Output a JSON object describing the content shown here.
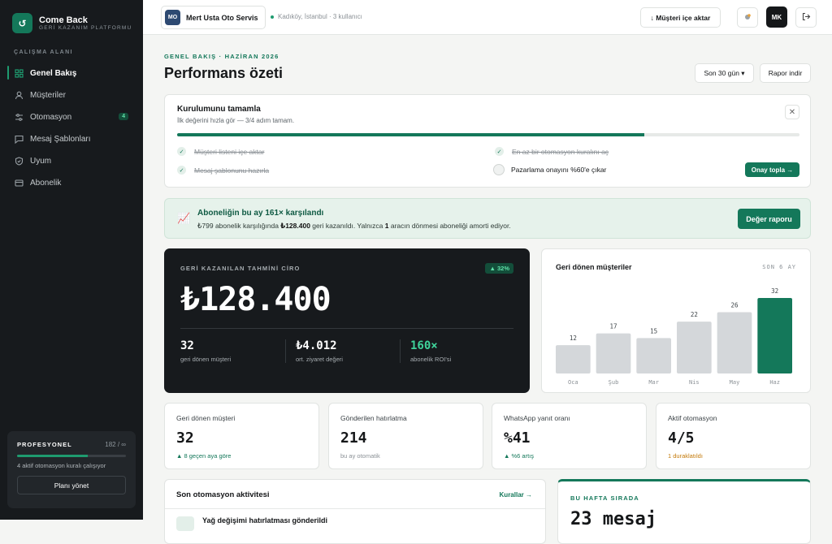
{
  "brand": {
    "logo": "↺",
    "name": "Come Back",
    "subtitle": "GERİ KAZANIM PLATFORMU"
  },
  "sidebar": {
    "section_label": "ÇALIŞMA ALANI",
    "items": [
      {
        "label": "Genel Bakış",
        "icon": "grid-icon",
        "active": true
      },
      {
        "label": "Müşteriler",
        "icon": "user-icon"
      },
      {
        "label": "Otomasyon",
        "icon": "sliders-icon",
        "badge": "4"
      },
      {
        "label": "Mesaj Şablonları",
        "icon": "message-icon"
      },
      {
        "label": "Uyum",
        "icon": "shield-icon"
      },
      {
        "label": "Abonelik",
        "icon": "card-icon"
      }
    ],
    "plan": {
      "title": "PROFESYONEL",
      "count": "182 / ∞",
      "progress": 0.65,
      "note": "4 aktif otomasyon kuralı çalışıyor",
      "button": "Planı yönet"
    }
  },
  "topbar": {
    "workspace_initials": "MO",
    "workspace_name": "Mert Usta Oto Servis",
    "workspace_meta": "Kadıköy, İstanbul · 3 kullanıcı",
    "import_button": "↓  Müşteri içe aktar",
    "user_initials": "MK"
  },
  "page": {
    "eyebrow": "GENEL BAKIŞ · HAZİRAN 2026",
    "title": "Performans özeti",
    "range_select": "Son 30 gün ▾",
    "download_button": "Rapor indir"
  },
  "setup": {
    "title": "Kurulumunu tamamla",
    "subtitle": "İlk değerini hızla gör — 3/4 adım tamam.",
    "progress": 0.75,
    "steps": [
      {
        "label": "Müşteri listeni içe aktar",
        "done": true
      },
      {
        "label": "En az bir otomasyon kuralını aç",
        "done": true
      },
      {
        "label": "Mesaj şablonunu hazırla",
        "done": true
      },
      {
        "label": "Pazarlama onayını %60'e çıkar",
        "done": false
      }
    ],
    "action_button": "Onay topla →",
    "close": "✕",
    "check": "✓"
  },
  "roi": {
    "title": "Aboneliğin bu ay 161× karşılandı",
    "text_pre": "₺799 abonelik karşılığında ",
    "text_amount": "₺128.400",
    "text_mid": " geri kazanıldı. Yalnızca ",
    "text_count": "1",
    "text_post": " aracın dönmesi aboneliği amorti ediyor.",
    "button": "Değer raporu",
    "icon": "📈"
  },
  "revenue": {
    "label": "GERİ KAZANILAN TAHMİNİ CİRO",
    "badge": "▲ 32%",
    "value": "₺128.400",
    "stats": [
      {
        "value": "32",
        "label": "geri dönen müşteri"
      },
      {
        "value": "₺4.012",
        "label": "ort. ziyaret değeri"
      },
      {
        "value": "160×",
        "label": "abonelik ROI'si",
        "color": "#3fd39a"
      }
    ]
  },
  "chart_data": {
    "type": "bar",
    "title": "Geri dönen müşteriler",
    "range_label": "SON 6 AY",
    "categories": [
      "Oca",
      "Şub",
      "Mar",
      "Nis",
      "May",
      "Haz"
    ],
    "values": [
      12,
      17,
      15,
      22,
      26,
      32
    ],
    "ylim": [
      0,
      32
    ],
    "highlight_index": 5,
    "colors": {
      "bar": "#d4d7da",
      "highlight": "#14785a"
    }
  },
  "stats": [
    {
      "label": "Geri dönen müşteri",
      "value": "32",
      "note": "▲ 8 geçen aya göre",
      "note_color": "#14785a"
    },
    {
      "label": "Gönderilen hatırlatma",
      "value": "214",
      "note": "bu ay otomatik",
      "note_color": "#8b9196"
    },
    {
      "label": "WhatsApp yanıt oranı",
      "value": "%41",
      "note": "▲ %6 artış",
      "note_color": "#14785a"
    },
    {
      "label": "Aktif otomasyon",
      "value": "4/5",
      "note": "1 duraklatıldı",
      "note_color": "#c47a0a"
    }
  ],
  "activity": {
    "title": "Son otomasyon aktivitesi",
    "link": "Kurallar →",
    "first_item": "Yağ değişimi hatırlatması gönderildi"
  },
  "week": {
    "label": "BU HAFTA SIRADA",
    "value": "23 mesaj"
  },
  "colors": {
    "accent": "#14785a",
    "sidebar": "#171a1d"
  }
}
